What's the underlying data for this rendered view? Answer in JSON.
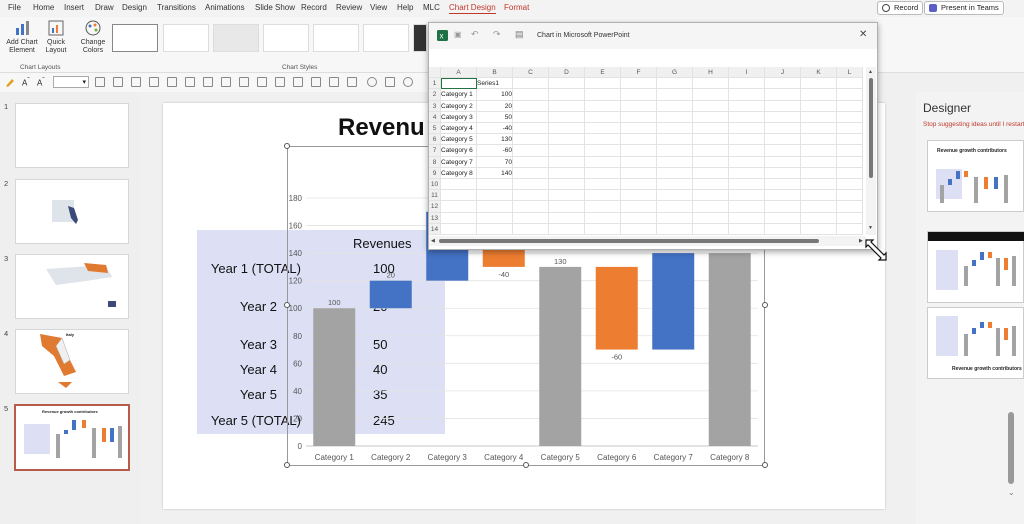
{
  "menu": {
    "items": [
      "File",
      "Home",
      "Insert",
      "Draw",
      "Design",
      "Transitions",
      "Animations",
      "Slide Show",
      "Record",
      "Review",
      "View",
      "Help",
      "MLC"
    ],
    "context_tabs": [
      "Chart Design",
      "Format"
    ],
    "record_label": "Record",
    "present_label": "Present in Teams"
  },
  "ribbon": {
    "add_chart_element": "Add Chart Element",
    "quick_layout": "Quick Layout",
    "change_colors": "Change Colors",
    "group_chart_layouts": "Chart Layouts",
    "group_chart_styles": "Chart Styles"
  },
  "slides": {
    "numbers": [
      "1",
      "2",
      "3",
      "4",
      "5"
    ],
    "thumb5_title": "Revenue growth contributors",
    "thumb4_title": "Italy"
  },
  "slide": {
    "title": "Revenu",
    "table": {
      "header": "Revenues",
      "rows": [
        {
          "label": "Year 1 (TOTAL)",
          "value": "100"
        },
        {
          "label": "Year 2",
          "value": "20"
        },
        {
          "label": "Year 3",
          "value": "50"
        },
        {
          "label": "Year 4",
          "value": "40"
        },
        {
          "label": "Year 5",
          "value": "35"
        },
        {
          "label": "Year 5 (TOTAL)",
          "value": "245"
        }
      ]
    }
  },
  "chart_data": {
    "type": "bar",
    "subtype": "waterfall",
    "title": "",
    "ylim": [
      0,
      180
    ],
    "yticks": [
      "0",
      "20",
      "40",
      "60",
      "80",
      "100",
      "120",
      "140",
      "160",
      "180"
    ],
    "categories": [
      "Category 1",
      "Category 2",
      "Category 3",
      "Category 4",
      "Category 5",
      "Category 6",
      "Category 7",
      "Category 8"
    ],
    "values": [
      100,
      20,
      50,
      -40,
      130,
      -60,
      70,
      140
    ],
    "data_labels": [
      "100",
      "20",
      "",
      "-40",
      "130",
      "-60",
      "",
      ""
    ],
    "colors": {
      "total": "#a3a3a3",
      "increase": "#4472c4",
      "decrease": "#ed7d31"
    },
    "grid": true
  },
  "excel": {
    "title": "Chart in Microsoft PowerPoint",
    "columns": [
      "A",
      "B",
      "C",
      "D",
      "E",
      "F",
      "G",
      "H",
      "I",
      "J",
      "K",
      "L"
    ],
    "row_numbers": [
      "1",
      "2",
      "3",
      "4",
      "5",
      "6",
      "7",
      "8",
      "9",
      "10",
      "11",
      "12",
      "13",
      "14"
    ],
    "header_b1": "Series1",
    "rows": [
      {
        "a": "Category 1",
        "b": "100"
      },
      {
        "a": "Category 2",
        "b": "20"
      },
      {
        "a": "Category 3",
        "b": "50"
      },
      {
        "a": "Category 4",
        "b": "-40"
      },
      {
        "a": "Category 5",
        "b": "130"
      },
      {
        "a": "Category 6",
        "b": "-60"
      },
      {
        "a": "Category 7",
        "b": "70"
      },
      {
        "a": "Category 8",
        "b": "140"
      }
    ]
  },
  "designer": {
    "title": "Designer",
    "stop_link": "Stop suggesting ideas until I restart",
    "thumb1_title": "Revenue growth contributors",
    "thumb3_title": "Revenue growth contributors"
  }
}
